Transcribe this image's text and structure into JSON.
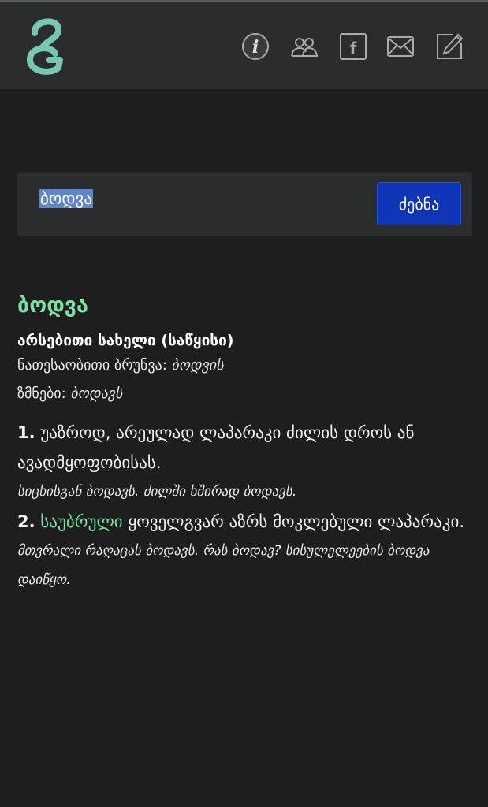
{
  "colors": {
    "background": "#1e1e1f",
    "header": "#2b2c2e",
    "accent": "#79e0a4",
    "button": "#0f34b6",
    "icon": "#a9aaad"
  },
  "header": {
    "logo": "G-logo",
    "icons": [
      "info-icon",
      "users-icon",
      "facebook-icon",
      "mail-icon",
      "edit-icon"
    ]
  },
  "search": {
    "query": "ბოდვა",
    "button_label": "ძებნა"
  },
  "entry": {
    "headword": "ბოდვა",
    "part_of_speech": "არსებითი სახელი (საწყისი)",
    "genitive_label": "ნათესაობითი ბრუნვა:",
    "genitive_form": "ბოდვის",
    "verbs_label": "ზმნები:",
    "verbs_form": "ბოდავს",
    "senses": [
      {
        "number": "1.",
        "usage_label": "",
        "definition": "უაზროდ, არეულად ლაპარაკი ძილის დროს ან ავადმყოფობისას.",
        "example": "სიცხისგან ბოდავს. ძილში ხშირად ბოდავს."
      },
      {
        "number": "2.",
        "usage_label": "საუბრული",
        "definition": "ყოველგვარ აზრს მოკლებული ლაპარაკი.",
        "example": "მთვრალი რაღაცას ბოდავს. რას ბოდავ? სისულელეების ბოდვა დაიწყო."
      }
    ]
  }
}
